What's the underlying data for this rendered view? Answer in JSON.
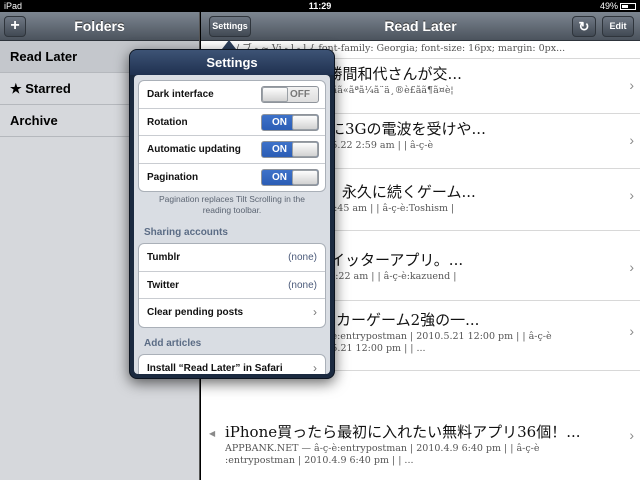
{
  "statusbar": {
    "device": "iPad",
    "time": "11:29",
    "battery": "49%"
  },
  "folders": {
    "title": "Folders",
    "add_label": "+",
    "items": [
      {
        "label": "Read Later"
      },
      {
        "label": "★ Starred"
      },
      {
        "label": "Archive"
      }
    ]
  },
  "main": {
    "title": "Read Later",
    "settings_label": "Settings",
    "edit_label": "Edit",
    "refresh_icon": "↻",
    "articles": [
      {
        "title": "~ / ブ - ~ Vi - l - l { font-family: Georgia; font-size: 16px; margin: 0px...",
        "meta1": "",
        "meta2": ""
      },
      {
        "title": "/速報：【速報】勝間和代さんが交...",
        "meta1": "~ - ãªãìã¾ã¤æ¬«ã¹ã£ãã«ãªã¼ã¨ä¸®è£ãã¶ã¤è¦",
        "meta2": ""
      },
      {
        "title": "写真レポ。上部に3Gの電波を受けや...",
        "meta1": ":entrypostman | 2010.5.22 2:59 am | | â-ç-è",
        "meta2": "2:59 am | | â-ç-è"
      },
      {
        "title": "Zynga: 危険！！永久に続くゲーム...",
        "meta1": ":Toshism | 2010.5.19 9:45 am | | â-ç-è:Toshism |",
        "meta2": ""
      },
      {
        "title": "出た！！公式ツイッターアプリ。...",
        "meta1": ":kazuend | 2010.5.20 2:22 am | | â-ç-è:kazuend |",
        "meta2": ""
      },
      {
        "title": "10: iPhoneサッカーゲーム2強の一...",
        "meta1": "APPBANK.NET — â-ç-è:entrypostman | 2010.5.21 12:00 pm | | â-ç-è",
        "meta2": ":entrypostman | 2010.5.21 12:00 pm | | ..."
      },
      {
        "title": "iPhone買ったら最初に入れたい無料アプリ36個！...",
        "meta1": "APPBANK.NET — â-ç-è:entrypostman | 2010.4.9 6:40 pm | | â-ç-è",
        "meta2": ":entrypostman | 2010.4.9 6:40 pm | | ..."
      }
    ]
  },
  "settings": {
    "title": "Settings",
    "toggles": [
      {
        "label": "Dark interface",
        "state": "OFF"
      },
      {
        "label": "Rotation",
        "state": "ON"
      },
      {
        "label": "Automatic updating",
        "state": "ON"
      },
      {
        "label": "Pagination",
        "state": "ON"
      }
    ],
    "note": "Pagination replaces Tilt Scrolling in the reading toolbar.",
    "sharing_header": "Sharing accounts",
    "sharing": [
      {
        "label": "Tumblr",
        "value": "(none)"
      },
      {
        "label": "Twitter",
        "value": "(none)"
      },
      {
        "label": "Clear pending posts",
        "value": "›"
      }
    ],
    "add_header": "Add articles",
    "add_items": [
      {
        "label": "Install “Read Later” in Safari",
        "value": "›"
      }
    ]
  }
}
